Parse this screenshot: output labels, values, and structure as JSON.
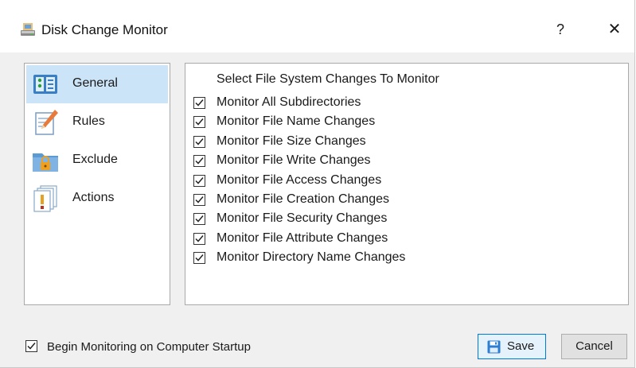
{
  "window": {
    "title": "Disk Change Monitor",
    "help_glyph": "?",
    "close_glyph": "✕"
  },
  "sidebar": {
    "items": [
      {
        "label": "General",
        "icon": "general-settings-icon",
        "selected": true
      },
      {
        "label": "Rules",
        "icon": "rules-pencil-icon",
        "selected": false
      },
      {
        "label": "Exclude",
        "icon": "exclude-lock-folder-icon",
        "selected": false
      },
      {
        "label": "Actions",
        "icon": "actions-alert-icon",
        "selected": false
      }
    ]
  },
  "main": {
    "heading": "Select File System Changes To Monitor",
    "options": [
      {
        "label": "Monitor All Subdirectories",
        "checked": true
      },
      {
        "label": "Monitor File Name Changes",
        "checked": true
      },
      {
        "label": "Monitor File Size Changes",
        "checked": true
      },
      {
        "label": "Monitor File Write Changes",
        "checked": true
      },
      {
        "label": "Monitor File Access Changes",
        "checked": true
      },
      {
        "label": "Monitor File Creation Changes",
        "checked": true
      },
      {
        "label": "Monitor File Security Changes",
        "checked": true
      },
      {
        "label": "Monitor File Attribute Changes",
        "checked": true
      },
      {
        "label": "Monitor Directory Name Changes",
        "checked": true
      }
    ]
  },
  "footer": {
    "startup_label": "Begin Monitoring on Computer Startup",
    "startup_checked": true,
    "save_label": "Save",
    "cancel_label": "Cancel"
  },
  "colors": {
    "selection": "#cce4f7",
    "accent": "#0078d7"
  }
}
